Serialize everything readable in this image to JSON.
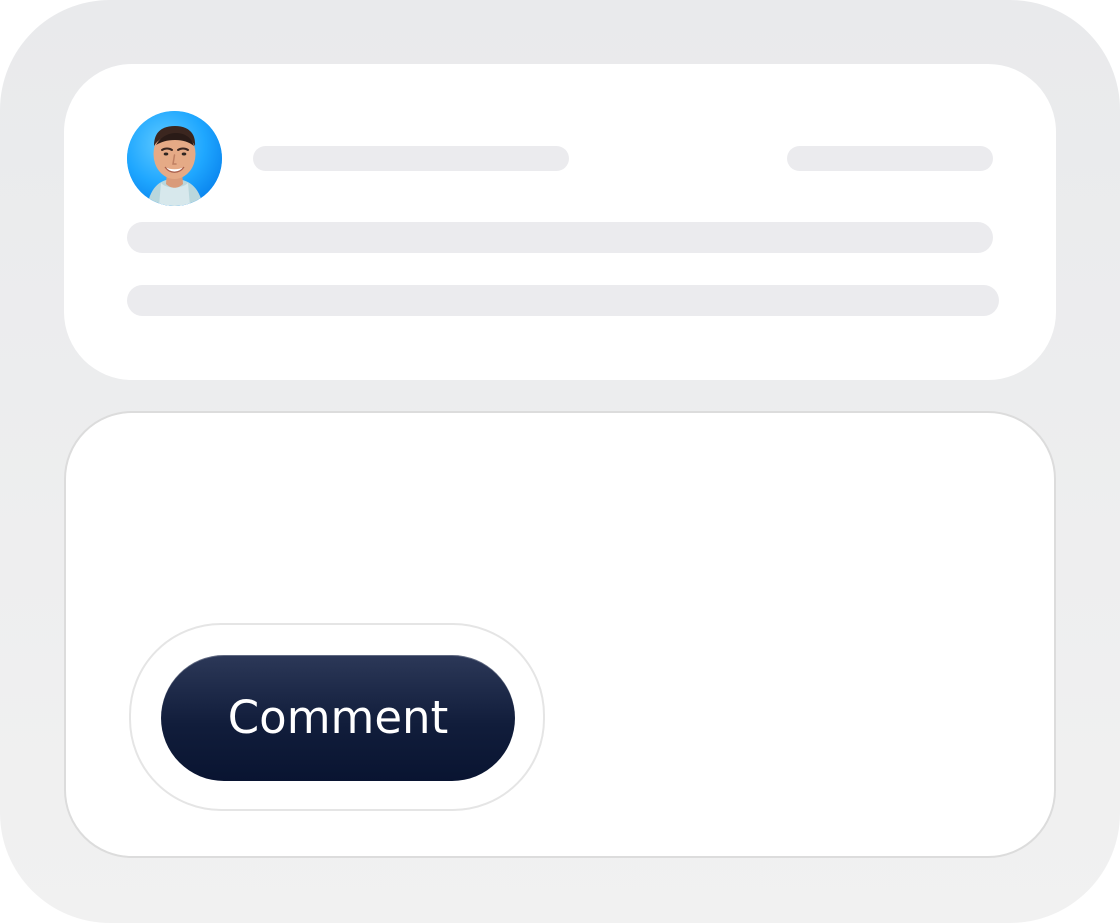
{
  "post": {
    "avatar_icon": "person-avatar"
  },
  "comment_box": {
    "button_label": "Comment"
  },
  "colors": {
    "frame_background": "#e9eaec",
    "card_background": "#ffffff",
    "skeleton": "#ebebee",
    "button_top": "#2c3858",
    "button_bottom": "#091431",
    "button_text": "#ffffff",
    "avatar_background": "#1fa7ff"
  }
}
